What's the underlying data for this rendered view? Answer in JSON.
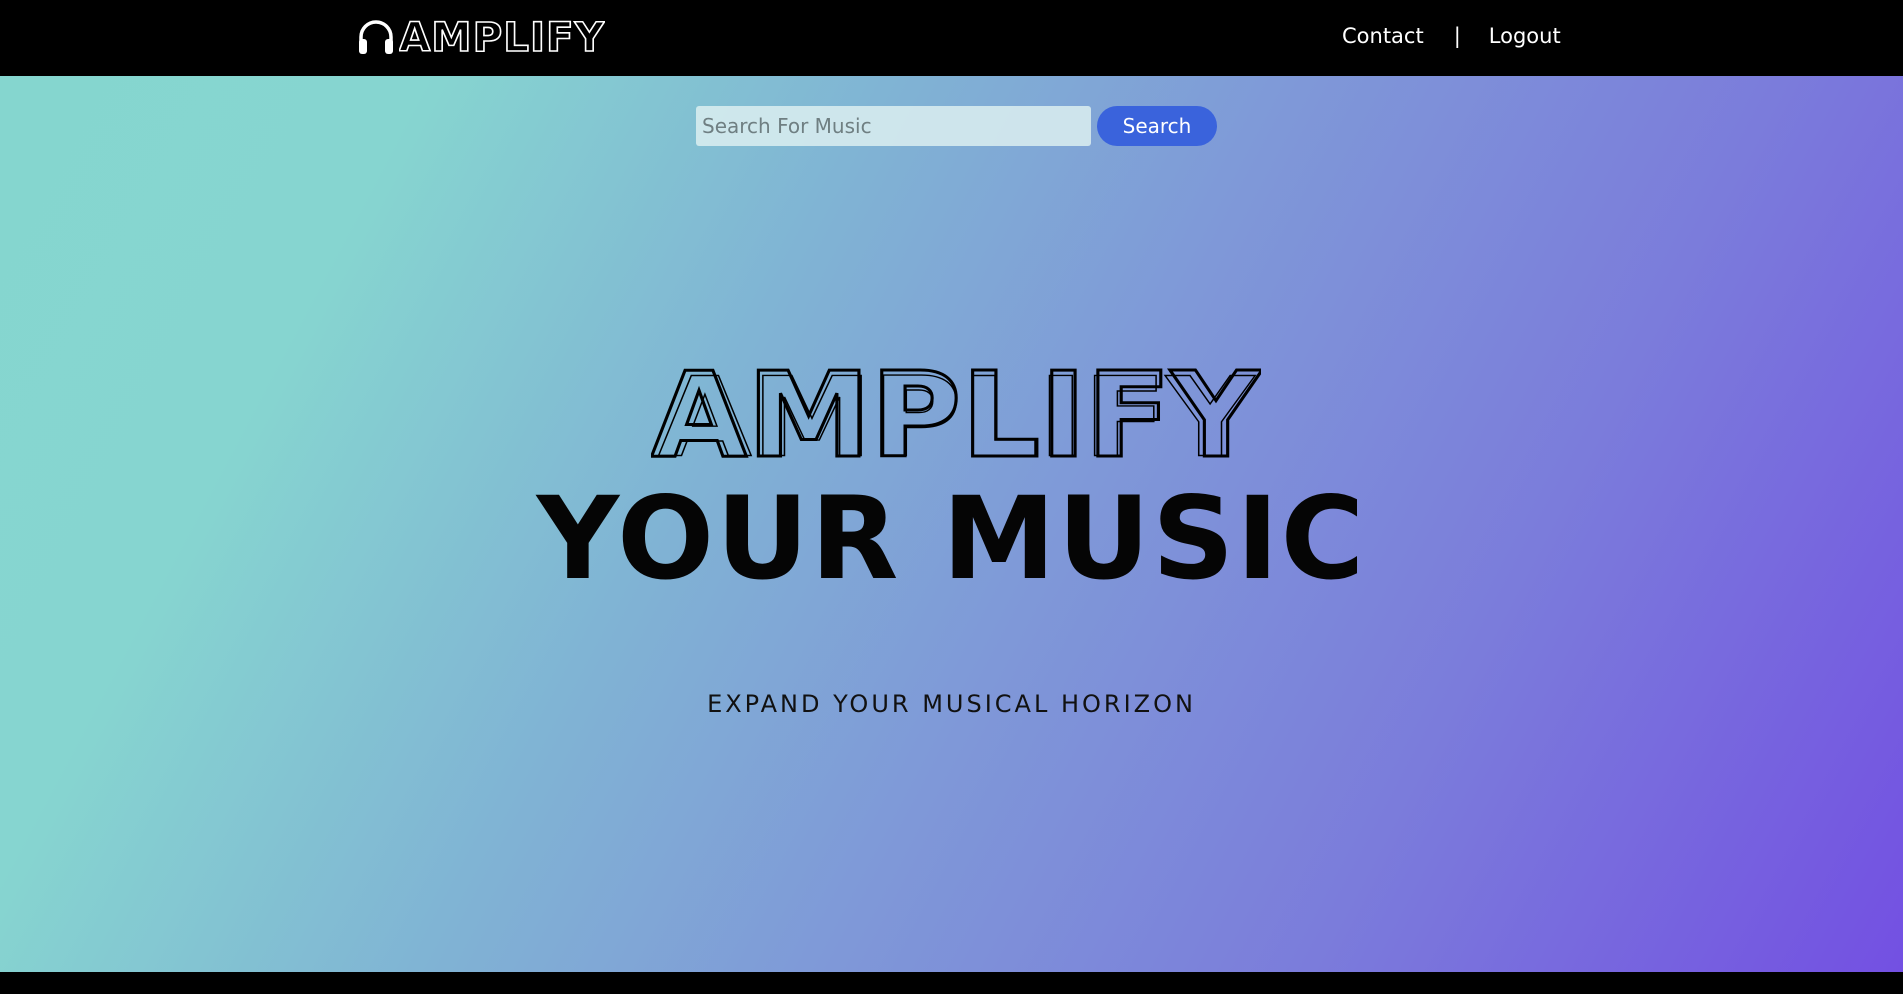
{
  "navbar": {
    "logo_text": "AMPLIFY",
    "links": [
      {
        "label": "Contact"
      },
      {
        "label": "Logout"
      }
    ],
    "separator": "|"
  },
  "search": {
    "placeholder": "Search For Music",
    "value": "",
    "button_label": "Search"
  },
  "hero": {
    "title": "AMPLIFY",
    "subtitle": "YOUR MUSIC",
    "tagline": "EXPAND YOUR MUSICAL HORIZON"
  },
  "colors": {
    "nav_background": "#000000",
    "gradient_start": "#85d6cf",
    "gradient_end": "#7350e2",
    "search_button": "#3a63dc"
  },
  "icons": {
    "logo_icon": "headphones-icon"
  }
}
